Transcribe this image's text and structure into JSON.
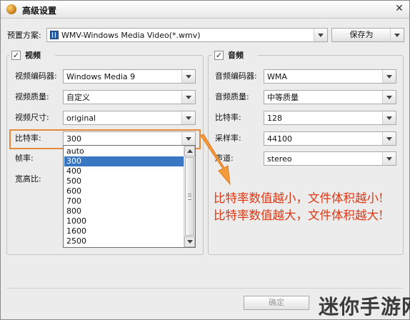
{
  "window": {
    "title": "高级设置"
  },
  "preset": {
    "label": "预置方案:",
    "value": "WMV-Windows Media Video(*.wmv)",
    "save_as": "保存为"
  },
  "video": {
    "legend": "视频",
    "checked": true,
    "fields": [
      {
        "label": "视频编码器:",
        "value": "Windows Media 9"
      },
      {
        "label": "视频质量:",
        "value": "自定义"
      },
      {
        "label": "视频尺寸:",
        "value": "original"
      },
      {
        "label": "比特率:",
        "value": "300"
      }
    ],
    "frame_rate_label": "帧率:",
    "aspect_label": "宽高比:"
  },
  "bitrate_dropdown": {
    "options": [
      "auto",
      "300",
      "400",
      "500",
      "600",
      "700",
      "800",
      "1000",
      "1600",
      "2500"
    ],
    "selected_index": 1
  },
  "audio": {
    "legend": "音频",
    "checked": true,
    "fields": [
      {
        "label": "音频编码器:",
        "value": "WMA"
      },
      {
        "label": "音频质量:",
        "value": "中等质量"
      },
      {
        "label": "比特率:",
        "value": "128"
      },
      {
        "label": "采样率:",
        "value": "44100"
      },
      {
        "label": "声道:",
        "value": "stereo"
      }
    ]
  },
  "annotation": {
    "line1": "比特率数值越小，文件体积越小!",
    "line2": "比特率数值越大，文件体积越大!",
    "color": "#e03510"
  },
  "footer": {
    "ok_label": "确定"
  },
  "watermark": "迷你手游网",
  "colors": {
    "highlight": "#e48a3a",
    "selection": "#3a77c2"
  },
  "icons": {
    "app": "app-logo-icon",
    "close": "close-icon",
    "video_file": "video-file-icon"
  }
}
